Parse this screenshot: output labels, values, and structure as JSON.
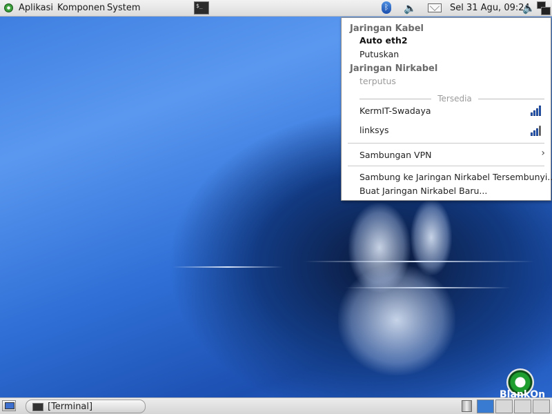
{
  "top_panel": {
    "menus": [
      "Aplikasi",
      "Komponen",
      "System"
    ],
    "terminal_glyph": "$_",
    "bluetooth_glyph": "ᛒ",
    "volume_glyph": "🔈",
    "clock": "Sel 31 Agu, 09:24"
  },
  "network_menu": {
    "wired_header": "Jaringan Kabel",
    "wired_connection": "Auto eth2",
    "disconnect": "Putuskan",
    "wireless_header": "Jaringan Nirkabel",
    "wireless_status": "terputus",
    "available_label": "Tersedia",
    "networks": [
      {
        "name": "KermIT-Swadaya",
        "signal_bars": 4
      },
      {
        "name": "linksys",
        "signal_bars": 3
      }
    ],
    "vpn": "Sambungan VPN",
    "vpn_arrow": "›",
    "hidden_network": "Sambung ke Jaringan Nirkabel Tersembunyi...",
    "new_network": "Buat Jaringan Nirkabel Baru..."
  },
  "bottom_panel": {
    "task_terminal": "[Terminal]",
    "active_workspace": 1,
    "workspaces": 4
  },
  "wallpaper": {
    "brand": "BlankOn"
  },
  "colors": {
    "accent": "#3a7bd2",
    "panel": "#e2e2e2",
    "desktop": "#2f6fd6"
  }
}
